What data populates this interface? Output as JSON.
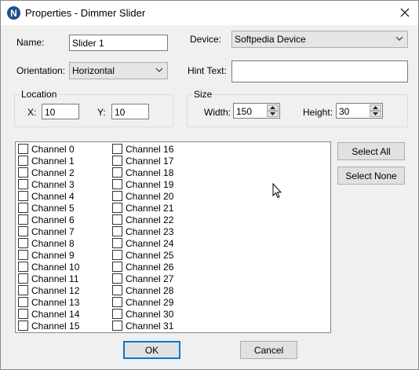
{
  "window": {
    "title": "Properties - Dimmer Slider",
    "app_icon_letter": "N"
  },
  "form": {
    "name_label": "Name:",
    "name_value": "Slider 1",
    "device_label": "Device:",
    "device_value": "Softpedia Device",
    "orientation_label": "Orientation:",
    "orientation_value": "Horizontal",
    "hint_label": "Hint Text:",
    "hint_value": ""
  },
  "location": {
    "title": "Location",
    "x_label": "X:",
    "x_value": "10",
    "y_label": "Y:",
    "y_value": "10"
  },
  "size": {
    "title": "Size",
    "width_label": "Width:",
    "width_value": "150",
    "height_label": "Height:",
    "height_value": "30"
  },
  "channels": [
    {
      "label": "Channel 0",
      "checked": false
    },
    {
      "label": "Channel 1",
      "checked": false
    },
    {
      "label": "Channel 2",
      "checked": false
    },
    {
      "label": "Channel 3",
      "checked": false
    },
    {
      "label": "Channel 4",
      "checked": false
    },
    {
      "label": "Channel 5",
      "checked": false
    },
    {
      "label": "Channel 6",
      "checked": false
    },
    {
      "label": "Channel 7",
      "checked": false
    },
    {
      "label": "Channel 8",
      "checked": false
    },
    {
      "label": "Channel 9",
      "checked": false
    },
    {
      "label": "Channel 10",
      "checked": false
    },
    {
      "label": "Channel 11",
      "checked": false
    },
    {
      "label": "Channel 12",
      "checked": false
    },
    {
      "label": "Channel 13",
      "checked": false
    },
    {
      "label": "Channel 14",
      "checked": false
    },
    {
      "label": "Channel 15",
      "checked": false
    },
    {
      "label": "Channel 16",
      "checked": false
    },
    {
      "label": "Channel 17",
      "checked": false
    },
    {
      "label": "Channel 18",
      "checked": false
    },
    {
      "label": "Channel 19",
      "checked": false
    },
    {
      "label": "Channel 20",
      "checked": false
    },
    {
      "label": "Channel 21",
      "checked": false
    },
    {
      "label": "Channel 22",
      "checked": false
    },
    {
      "label": "Channel 23",
      "checked": false
    },
    {
      "label": "Channel 24",
      "checked": false
    },
    {
      "label": "Channel 25",
      "checked": false
    },
    {
      "label": "Channel 26",
      "checked": false
    },
    {
      "label": "Channel 27",
      "checked": false
    },
    {
      "label": "Channel 28",
      "checked": false
    },
    {
      "label": "Channel 29",
      "checked": false
    },
    {
      "label": "Channel 30",
      "checked": false
    },
    {
      "label": "Channel 31",
      "checked": false
    }
  ],
  "buttons": {
    "select_all": "Select All",
    "select_none": "Select None",
    "ok": "OK",
    "cancel": "Cancel"
  },
  "colors": {
    "window_bg": "#f0f0f0",
    "accent": "#0078d7",
    "app_icon": "#1e4f8f"
  }
}
